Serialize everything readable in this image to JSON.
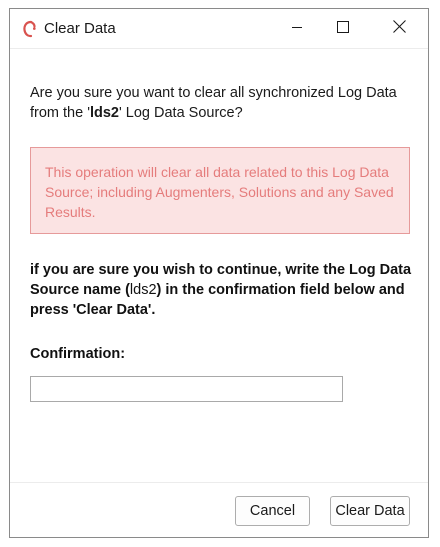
{
  "window": {
    "title": "Clear Data",
    "icon": "app-logo-icon",
    "controls": {
      "minimize_icon": "minimize-icon",
      "maximize_icon": "maximize-icon",
      "close_icon": "close-icon"
    }
  },
  "dialog": {
    "question_prefix": "Are you sure you want to clear all synchronized Log Data from the '",
    "source_name": "lds2",
    "question_suffix": "' Log Data Source?",
    "warning": "This operation will clear all data related to this Log Data Source; including Augmenters, Solutions and any Saved Results.",
    "instructions_prefix": "if you are sure you wish to continue, write the Log Data Source name (",
    "instructions_name": "lds2",
    "instructions_suffix": ") in the confirmation field below and press 'Clear Data'.",
    "confirmation_label": "Confirmation:",
    "confirmation_value": "",
    "confirmation_placeholder": ""
  },
  "buttons": {
    "cancel": "Cancel",
    "clear": "Clear Data"
  },
  "colors": {
    "warning_bg": "#fbe3e3",
    "warning_border": "#e69a9a",
    "warning_text": "#e57c7c",
    "icon_accent": "#d9534f"
  }
}
